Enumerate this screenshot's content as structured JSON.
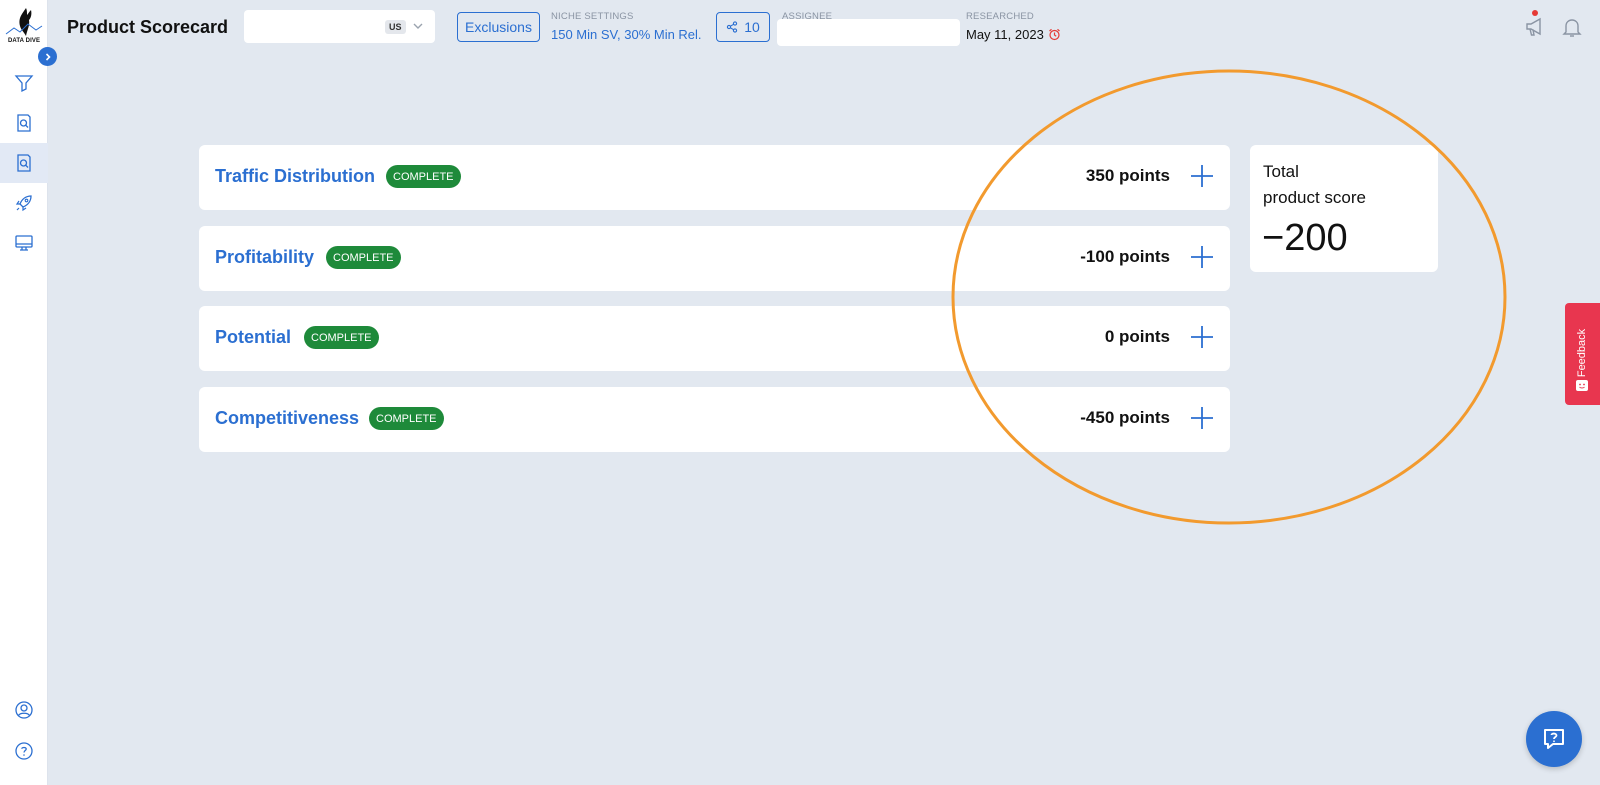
{
  "app": {
    "logo_text": "DATA DIVE",
    "page_title": "Product Scorecard",
    "accent_color": "#2b6fd1",
    "complete_color": "#1e8a3a"
  },
  "sidebar": {
    "items": [
      {
        "icon": "filter-icon"
      },
      {
        "icon": "document-search-icon"
      },
      {
        "icon": "document-search-icon",
        "active": true
      },
      {
        "icon": "rocket-icon"
      },
      {
        "icon": "monitor-icon"
      }
    ],
    "bottom_items": [
      {
        "icon": "user-circle-icon"
      },
      {
        "icon": "help-circle-icon"
      }
    ]
  },
  "header": {
    "product_select": {
      "value": "",
      "country": "US"
    },
    "exclusions_label": "Exclusions",
    "niche_settings": {
      "label": "NICHE SETTINGS",
      "value": "150 Min SV, 30% Min Rel."
    },
    "share": {
      "count": "10"
    },
    "assignee": {
      "label": "ASSIGNEE",
      "value": ""
    },
    "researched": {
      "label": "RESEARCHED",
      "value": "May 11, 2023"
    }
  },
  "scorecard": {
    "categories": [
      {
        "title": "Traffic Distribution",
        "status": "COMPLETE",
        "points": "350 points"
      },
      {
        "title": "Profitability",
        "status": "COMPLETE",
        "points": "-100 points"
      },
      {
        "title": "Potential",
        "status": "COMPLETE",
        "points": "0 points"
      },
      {
        "title": "Competitiveness",
        "status": "COMPLETE",
        "points": "-450 points"
      }
    ],
    "total": {
      "label_line1": "Total",
      "label_line2": "product score",
      "value": "−200"
    }
  },
  "widgets": {
    "feedback_label": "Feedback"
  }
}
